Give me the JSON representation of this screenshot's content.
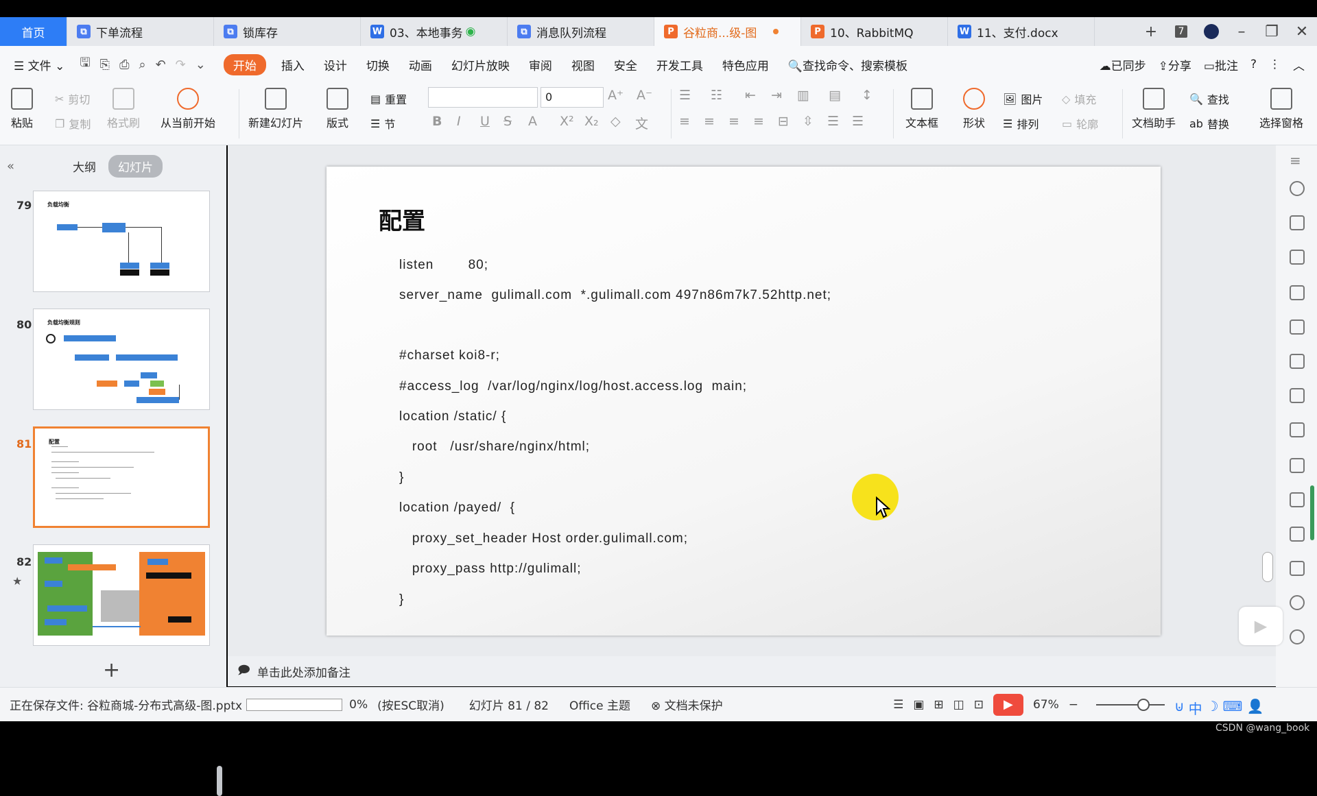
{
  "tabs": [
    {
      "label": "首页",
      "type": "home"
    },
    {
      "label": "下单流程",
      "type": "blue"
    },
    {
      "label": "锁库存",
      "type": "blue"
    },
    {
      "label": "03、本地事务",
      "type": "word"
    },
    {
      "label": "消息队列流程",
      "type": "blue"
    },
    {
      "label": "谷粒商...级-图",
      "type": "ppt",
      "active": true
    },
    {
      "label": "10、RabbitMQ",
      "type": "ppt"
    },
    {
      "label": "11、支付.docx",
      "type": "word"
    }
  ],
  "tab_controls": {
    "add": "+",
    "count": "7"
  },
  "menu": {
    "file": "文件",
    "items": [
      "开始",
      "插入",
      "设计",
      "切换",
      "动画",
      "幻灯片放映",
      "审阅",
      "视图",
      "安全",
      "开发工具",
      "特色应用"
    ],
    "search": "查找命令、搜索模板",
    "synced": "已同步",
    "share": "分享",
    "comment": "批注"
  },
  "ribbon": {
    "paste": "粘贴",
    "cut": "剪切",
    "copy": "复制",
    "format_painter": "格式刷",
    "play_from_current": "从当前开始",
    "new_slide": "新建幻灯片",
    "layout": "版式",
    "reset": "重置",
    "section": "节",
    "font_size": "0",
    "textbox": "文本框",
    "shape": "形状",
    "picture": "图片",
    "fill": "填充",
    "arrange": "排列",
    "outline": "轮廓",
    "doc_assistant": "文档助手",
    "find": "查找",
    "replace": "替换",
    "select_pane": "选择窗格"
  },
  "left_panel": {
    "outline_tab": "大纲",
    "slides_tab": "幻灯片",
    "slides": [
      {
        "num": "79",
        "title": "负载均衡"
      },
      {
        "num": "80",
        "title": "负载均衡规则"
      },
      {
        "num": "81",
        "title": "配置",
        "active": true
      },
      {
        "num": "82",
        "title": ""
      }
    ]
  },
  "slide": {
    "title": "配置",
    "lines": [
      "listen        80;",
      "server_name  gulimall.com  *.gulimall.com 497n86m7k7.52http.net;",
      "",
      "#charset koi8-r;",
      "#access_log  /var/log/nginx/log/host.access.log  main;",
      "location /static/ {",
      "   root   /usr/share/nginx/html;",
      "}",
      "location /payed/  {",
      "   proxy_set_header Host order.gulimall.com;",
      "   proxy_pass http://gulimall;",
      "}"
    ]
  },
  "notes_placeholder": "单击此处添加备注",
  "status": {
    "saving": "正在保存文件: 谷粒商城-分布式高级-图.pptx",
    "percent": "0%",
    "cancel_hint": "(按ESC取消)",
    "slide_counter": "幻灯片 81 / 82",
    "theme": "Office 主题",
    "protect": "文档未保护",
    "zoom": "67%"
  },
  "ime": "中",
  "watermark": "CSDN @wang_book",
  "colors": {
    "accent": "#ef6a2c",
    "home_tab": "#2d7df6",
    "highlight": "#f7e21c"
  }
}
